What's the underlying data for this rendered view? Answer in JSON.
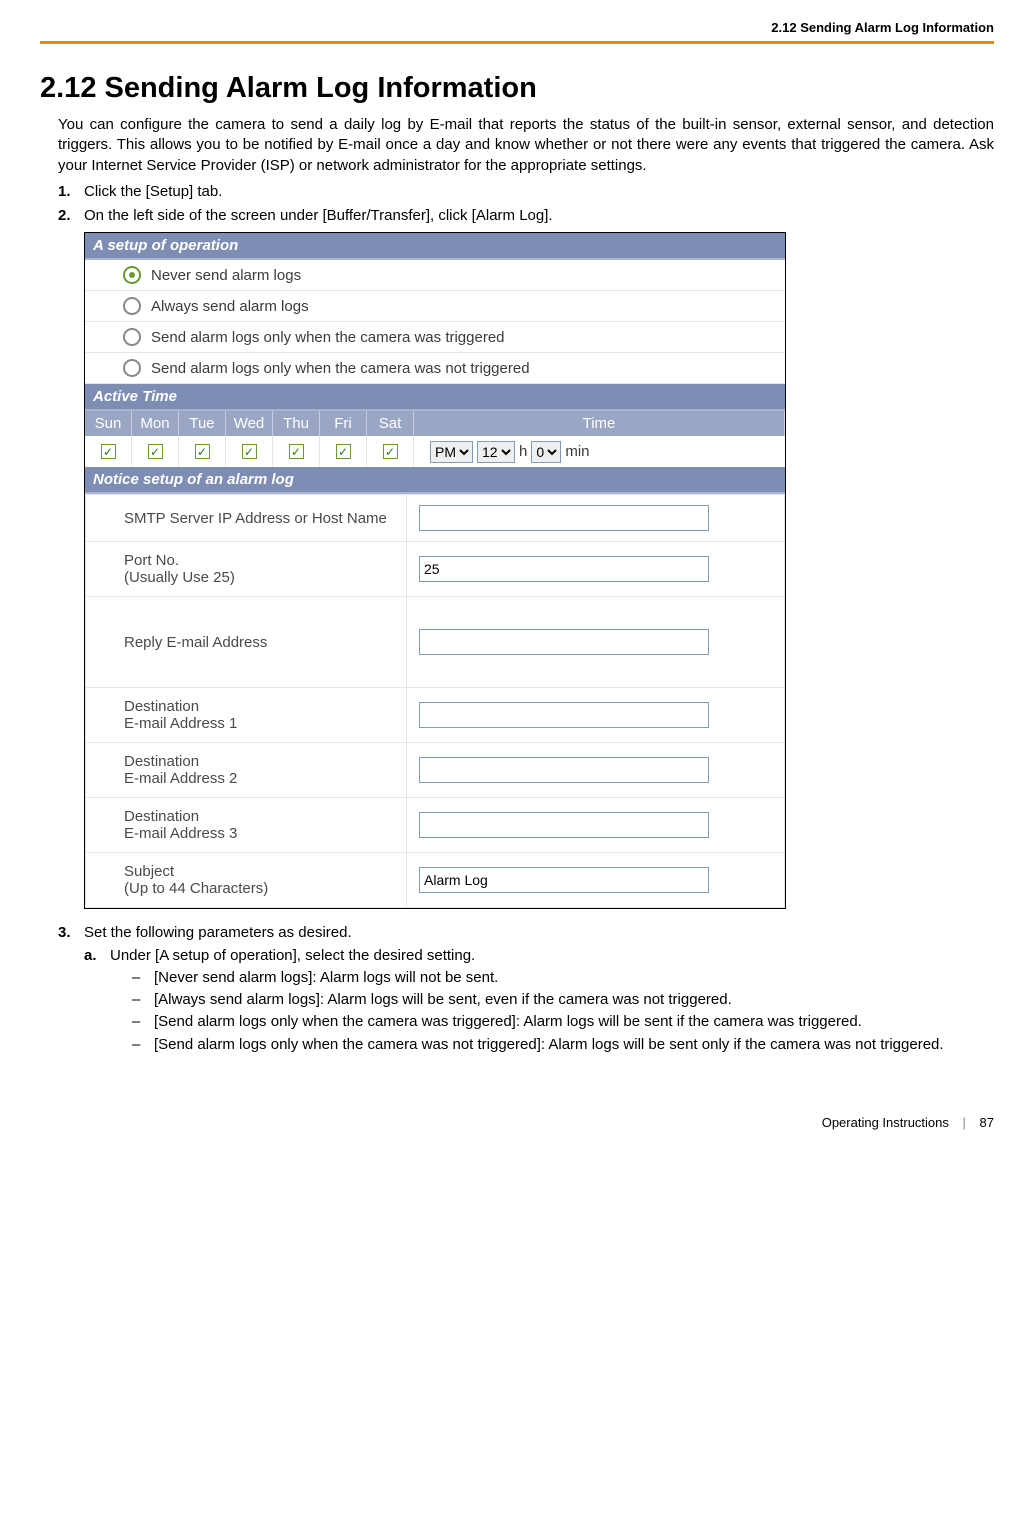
{
  "running_header": "2.12 Sending Alarm Log Information",
  "title": "2.12  Sending Alarm Log Information",
  "intro": "You can configure the camera to send a daily log by E-mail that reports the status of the built-in sensor, external sensor, and detection triggers. This allows you to be notified by E-mail once a day and know whether or not there were any events that triggered the camera. Ask your Internet Service Provider (ISP) or network administrator for the appropriate settings.",
  "steps": {
    "s1": {
      "num": "1.",
      "text": "Click the [Setup] tab."
    },
    "s2": {
      "num": "2.",
      "text": "On the left side of the screen under [Buffer/Transfer], click [Alarm Log]."
    },
    "s3": {
      "num": "3.",
      "text": "Set the following parameters as desired."
    }
  },
  "substeps": {
    "a": {
      "letter": "a.",
      "text": "Under [A setup of operation], select the desired setting."
    }
  },
  "bullets": {
    "b1": "[Never send alarm logs]: Alarm logs will not be sent.",
    "b2": "[Always send alarm logs]: Alarm logs will be sent, even if the camera was not triggered.",
    "b3": "[Send alarm logs only when the camera was triggered]: Alarm logs will be sent if the camera was triggered.",
    "b4": "[Send alarm logs only when the camera was not triggered]: Alarm logs will be sent only if the camera was not triggered."
  },
  "embed": {
    "setup_header": "A setup of operation",
    "radios": {
      "r1": "Never send alarm logs",
      "r2": "Always send alarm logs",
      "r3": "Send alarm logs only when the camera was triggered",
      "r4": "Send alarm logs only when the camera was not triggered"
    },
    "active_time_header": "Active Time",
    "days": {
      "sun": "Sun",
      "mon": "Mon",
      "tue": "Tue",
      "wed": "Wed",
      "thu": "Thu",
      "fri": "Fri",
      "sat": "Sat"
    },
    "time_label": "Time",
    "time": {
      "ampm": "PM",
      "hour": "12",
      "h_label": "h",
      "min": "0",
      "min_label": "min"
    },
    "notice_header": "Notice setup of an alarm log",
    "fields": {
      "smtp": {
        "label": "SMTP Server IP Address or Host Name",
        "value": ""
      },
      "port": {
        "label": "Port No.\n(Usually Use 25)",
        "value": "25"
      },
      "reply": {
        "label": "Reply E-mail Address",
        "value": ""
      },
      "dest1": {
        "label": "Destination\nE-mail Address 1",
        "value": ""
      },
      "dest2": {
        "label": "Destination\nE-mail Address 2",
        "value": ""
      },
      "dest3": {
        "label": "Destination\nE-mail Address 3",
        "value": ""
      },
      "subject": {
        "label": "Subject\n(Up to 44 Characters)",
        "value": "Alarm Log"
      }
    }
  },
  "footer": {
    "doc": "Operating Instructions",
    "page": "87"
  }
}
